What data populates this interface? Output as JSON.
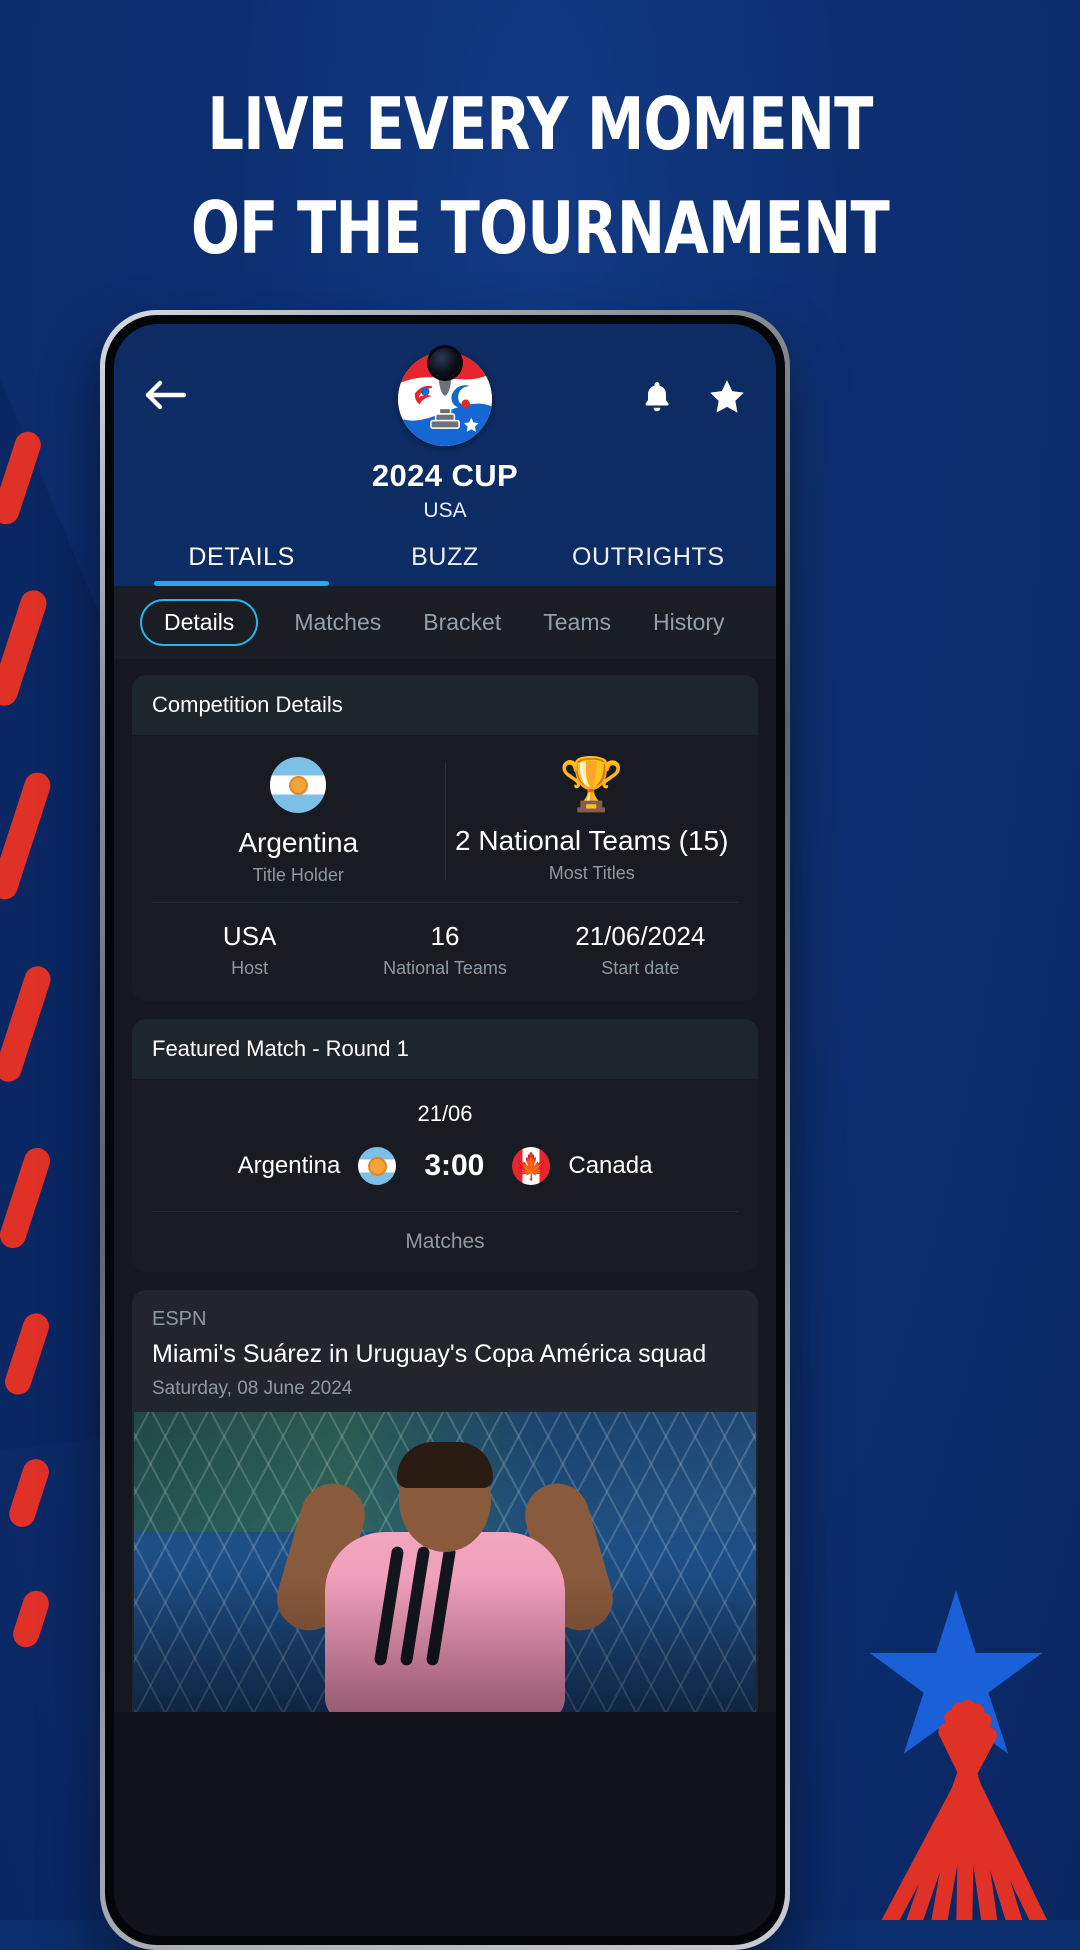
{
  "promo": {
    "line1": "LIVE EVERY MOMENT",
    "line2": "OF THE TOURNAMENT",
    "background_color": "#0b2d6b",
    "accent_red": "#e03127",
    "accent_blue": "#1b5fd9"
  },
  "app": {
    "header": {
      "back_icon": "back-arrow-icon",
      "notification_icon": "bell-icon",
      "favorite_icon": "star-icon",
      "logo_icon": "competition-logo-icon",
      "title": "2024 CUP",
      "subtitle": "USA",
      "accent_color": "#29a6e8"
    },
    "tabs": [
      {
        "label": "DETAILS",
        "active": true
      },
      {
        "label": "BUZZ",
        "active": false
      },
      {
        "label": "OUTRIGHTS",
        "active": false
      }
    ],
    "chips": [
      {
        "label": "Details",
        "active": true
      },
      {
        "label": "Matches",
        "active": false
      },
      {
        "label": "Bracket",
        "active": false
      },
      {
        "label": "Teams",
        "active": false
      },
      {
        "label": "History",
        "active": false
      }
    ],
    "competition_details": {
      "card_title": "Competition Details",
      "top_stats": [
        {
          "value": "Argentina",
          "label": "Title Holder",
          "icon": "argentina-flag-icon"
        },
        {
          "value": "2 National Teams (15)",
          "label": "Most Titles",
          "icon": "trophy-icon"
        }
      ],
      "bottom_stats": [
        {
          "value": "USA",
          "label": "Host"
        },
        {
          "value": "16",
          "label": "National Teams"
        },
        {
          "value": "21/06/2024",
          "label": "Start date"
        }
      ]
    },
    "featured_match": {
      "card_title": "Featured Match - Round 1",
      "date": "21/06",
      "home_team": "Argentina",
      "home_flag": "argentina-flag-icon",
      "time": "3:00",
      "away_team": "Canada",
      "away_flag": "canada-flag-icon",
      "footer_link": "Matches"
    },
    "news": {
      "source": "ESPN",
      "headline": "Miami's Suárez in Uruguay's Copa América squad",
      "date": "Saturday, 08 June 2024",
      "image_alt": "footballer-celebrating-photo"
    }
  }
}
